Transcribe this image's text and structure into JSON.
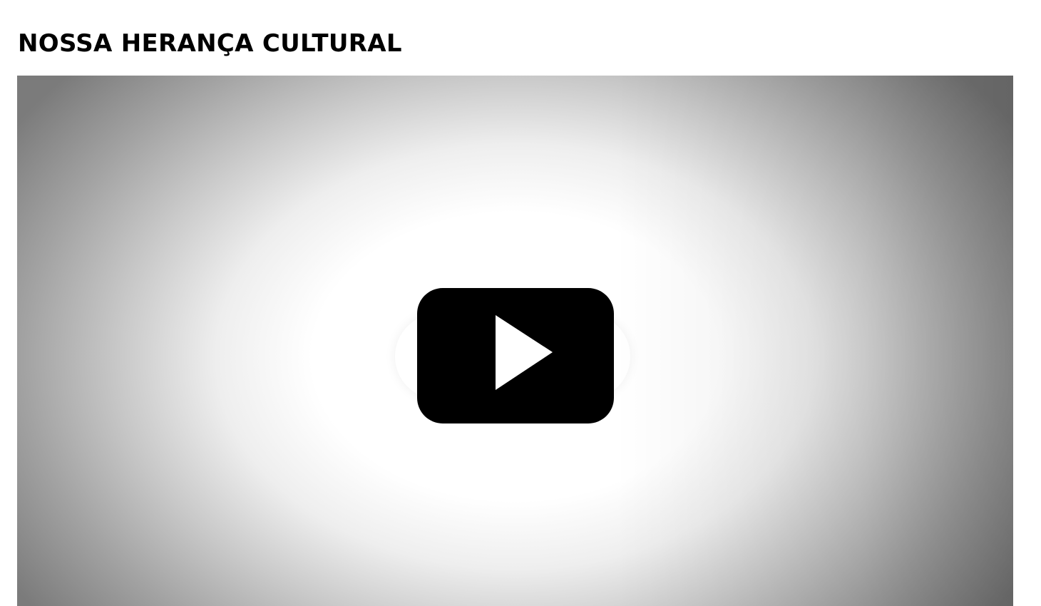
{
  "page": {
    "title": "NOSSA HERANÇA CULTURAL"
  },
  "video": {
    "play_icon": "play-icon"
  },
  "colors": {
    "play_button": "#000000",
    "play_triangle": "#ffffff",
    "vignette_edge": "#7b7b7b"
  }
}
